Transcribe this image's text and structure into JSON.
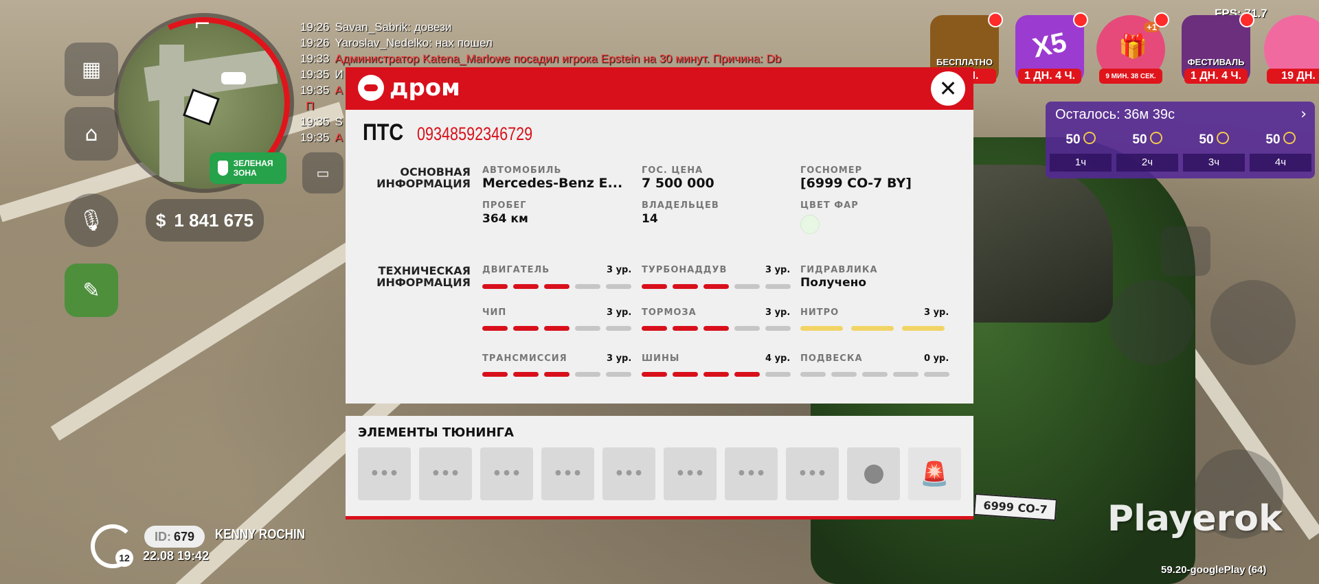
{
  "chat": [
    {
      "time": "19:26",
      "text": "Savan_Sabrik: довези",
      "color": "white"
    },
    {
      "time": "19:26",
      "text": "Yaroslav_Nedelko: нах пошел",
      "color": "white"
    },
    {
      "time": "19:33",
      "text": "Администратор Katena_Marlowe посадил игрока Epstein на 30 минут. Причина: Db",
      "color": "red"
    },
    {
      "time": "19:35",
      "text": "И",
      "color": "white"
    },
    {
      "time": "19:35",
      "text": "А",
      "color": "red"
    },
    {
      "time": "",
      "text": "П",
      "color": "red"
    },
    {
      "time": "19:35",
      "text": "S",
      "color": "white"
    },
    {
      "time": "19:35",
      "text": "А",
      "color": "red"
    }
  ],
  "hud": {
    "zone_label": "ЗЕЛЕНАЯ ЗОНА",
    "money": "1 841 675",
    "currency_symbol": "$",
    "fps": "FPS: 71.7"
  },
  "events": [
    {
      "label": "БЕСПЛАТНО",
      "badge": "МИН.",
      "color": "#8a5a1c"
    },
    {
      "label": "",
      "badge": "1 ДН. 4 Ч.",
      "color": "#9b3bd0",
      "center": "X5"
    },
    {
      "label": "",
      "badge": "9 МИН. 38 СЕК.",
      "color": "#e64a7a",
      "plus": "+1"
    },
    {
      "label": "ФЕСТИВАЛЬ",
      "badge": "1 ДН. 4 Ч.",
      "color": "#6b2f7d"
    },
    {
      "label": "",
      "badge": "19 ДН.",
      "color": "#f06aa0"
    }
  ],
  "reward_timer": {
    "title": "Осталось: 36м 39с",
    "cells": [
      {
        "value": "50",
        "hour": "1ч"
      },
      {
        "value": "50",
        "hour": "2ч"
      },
      {
        "value": "50",
        "hour": "3ч"
      },
      {
        "value": "50",
        "hour": "4ч"
      }
    ]
  },
  "dialog": {
    "brand": "дром",
    "doc_label": "ПТС",
    "doc_number": "09348592346729",
    "basic_title_1": "ОСНОВНАЯ",
    "basic_title_2": "ИНФОРМАЦИЯ",
    "car_label": "АВТОМОБИЛЬ",
    "car_value": "Mercedes-Benz E...",
    "price_label": "ГОС. ЦЕНА",
    "price_value": "7 500 000",
    "plate_label": "ГОСНОМЕР",
    "plate_value": "[6999 СО-7 BY]",
    "mileage_label": "ПРОБЕГ",
    "mileage_value": "364 км",
    "owners_label": "ВЛАДЕЛЬЦЕВ",
    "owners_value": "14",
    "lights_label": "ЦВЕТ ФАР",
    "lights_color": "#e7f7e4",
    "tech_title_1": "ТЕХНИЧЕСКАЯ",
    "tech_title_2": "ИНФОРМАЦИЯ",
    "engine_label": "ДВИГАТЕЛЬ",
    "engine_level": "3 ур.",
    "engine_value": 3,
    "turbo_label": "ТУРБОНАДДУВ",
    "turbo_level": "3 ур.",
    "turbo_value": 3,
    "hydraulics_label": "ГИДРАВЛИКА",
    "hydraulics_value": "Получено",
    "chip_label": "ЧИП",
    "chip_level": "3 ур.",
    "chip_value": 3,
    "brakes_label": "ТОРМОЗА",
    "brakes_level": "3 ур.",
    "brakes_value": 3,
    "nitro_label": "НИТРО",
    "nitro_level": "3 ур.",
    "nitro_value": 3,
    "transmission_label": "ТРАНСМИССИЯ",
    "transmission_level": "3 ур.",
    "transmission_value": 3,
    "tires_label": "ШИНЫ",
    "tires_level": "4 ур.",
    "tires_value": 4,
    "suspension_label": "ПОДВЕСКА",
    "suspension_level": "0 ур.",
    "suspension_value": 0
  },
  "tuning": {
    "title": "ЭЛЕМЕНТЫ ТЮНИНГА",
    "slots": [
      "•••",
      "•••",
      "•••",
      "•••",
      "•••",
      "•••",
      "•••",
      "•••",
      "horn-icon",
      "siren-icon"
    ]
  },
  "player": {
    "id_prefix": "ID:",
    "id": "679",
    "name": "KENNY ROCHIN",
    "datetime": "22.08 19:42",
    "level": "12"
  },
  "plate_on_car": "6999 СО-7",
  "watermark": "Playerok",
  "version": "59.20-googlePlay (64)"
}
